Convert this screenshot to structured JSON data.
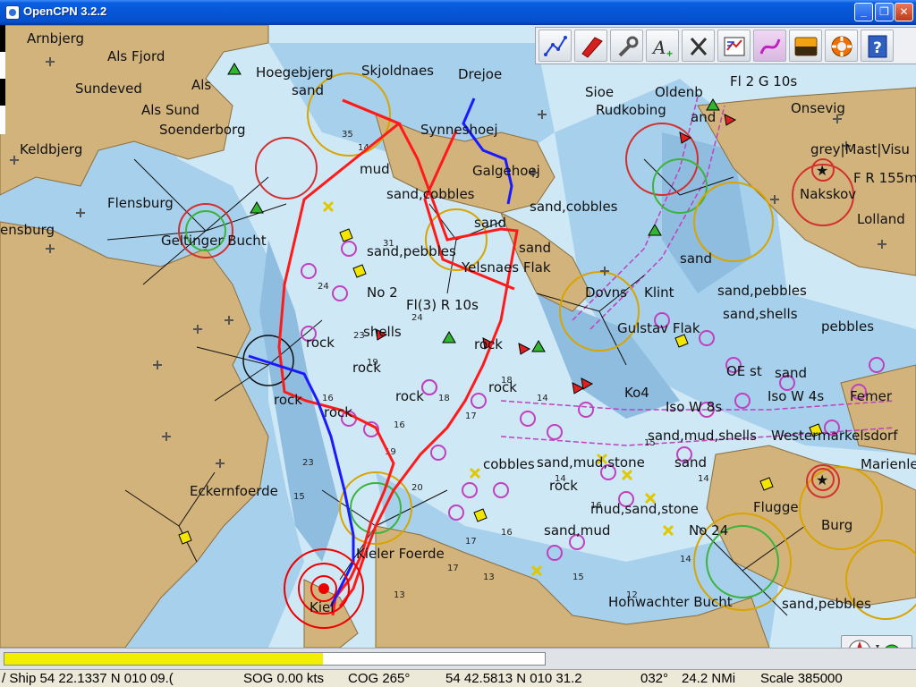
{
  "window": {
    "title": "OpenCPN 3.2.2",
    "minimize_glyph": "_",
    "maximize_glyph": "❐",
    "close_glyph": "✕"
  },
  "toolbar": {
    "tools": [
      {
        "name": "route-icon",
        "tooltip": ""
      },
      {
        "name": "ship-icon",
        "tooltip": ""
      },
      {
        "name": "wrench-icon",
        "tooltip": ""
      },
      {
        "name": "text-toggle-icon",
        "tooltip": ""
      },
      {
        "name": "clear-icon",
        "tooltip": ""
      },
      {
        "name": "route-manager-icon",
        "tooltip": ""
      },
      {
        "name": "track-icon",
        "tooltip": ""
      },
      {
        "name": "color-scheme-icon",
        "tooltip": ""
      },
      {
        "name": "lifebuoy-icon",
        "tooltip": ""
      },
      {
        "name": "help-icon",
        "tooltip": ""
      }
    ]
  },
  "chart": {
    "place_labels": {
      "arnbjerg": "Arnbjerg",
      "als_fjord": "Als Fjord",
      "sundeved": "Sundeved",
      "als": "Als",
      "als_sund": "Als Sund",
      "soenderborg": "Soenderborg",
      "keldbjerg": "Keldbjerg",
      "flensburg": "Flensburg",
      "ensburg": "ensburg",
      "geltinger_bucht": "Geltinger Bucht",
      "hoegebjerg": "Hoegebjerg",
      "sand1": "sand",
      "skjoldnaes": "Skjoldnaes",
      "drejoe": "Drejoe",
      "sioe": "Sioe",
      "rudkobing": "Rudkobing",
      "oldenburg": "Oldenb",
      "onsevig": "Onsevig",
      "synneshoej": "Synneshoej",
      "galgehoej": "Galgehoej",
      "mud1": "mud",
      "sand_cobbles": "sand,cobbles",
      "sand_cobbles2": "sand,cobbles",
      "sand_pebbles": "sand,pebbles",
      "yelsnaes_flak": "Yelsnaes Flak",
      "dovns": "Dovns",
      "klint": "Klint",
      "no2": "No 2",
      "fl3r10s": "Fl(3) R 10s",
      "shells": "shells",
      "rock1": "rock",
      "rock2": "rock",
      "rock3": "rock",
      "rock4": "rock",
      "rock5": "rock",
      "rock6": "rock",
      "rock7": "rock",
      "rock8": "rock",
      "ko4": "Ko4",
      "iso_w8s": "Iso W 8s",
      "sand_mud_shells": "sand,mud,shells",
      "sand_mud_stone": "sand,mud,stone",
      "sand_mud": "sand,mud",
      "mud_sand_stone": "mud,sand,stone",
      "kieler_foerde": "Kieler Foerde",
      "kiel": "Kiel",
      "hohwachter_bucht": "Hohwachter Bucht",
      "eckernfoerde": "Eckernfoerde",
      "nakskov": "Nakskov",
      "lolland": "Lolland",
      "grey_mast": "grey|Mast|Visu",
      "fr155m": "F R 155m",
      "sand_pebbles2": "sand,pebbles",
      "sand_shells": "sand,shells",
      "pebbles": "pebbles",
      "femer": "Femer",
      "marienleuchte": "Marienle",
      "westermarkelsdorf": "Westermarkelsdorf",
      "flugge": "Flugge",
      "burg": "Burg",
      "sand_pebbles3": "sand,pebbles",
      "oe_st": "OE st",
      "iso_w4s": "Iso W 4s",
      "gulstav": "Gulstav Flak",
      "sand2": "sand",
      "sand3": "sand",
      "sand4": "sand",
      "sand5": "sand",
      "sand6": "sand",
      "fl2g10s": "Fl 2 G 10s",
      "no24": "No 24",
      "langeland": "and",
      "cobbles": "cobbles"
    }
  },
  "status": {
    "ship": "/ Ship 54 22.1337 N   010 09.(",
    "sog": "SOG 0.00 kts",
    "cog": "COG 265°",
    "cursor": "54 42.5813 N   010 31.2",
    "bearing": "032°",
    "distance": "24.2 NMi",
    "scale": "Scale 385000",
    "progress": 0.59
  },
  "colors": {
    "land": "#d3b37c",
    "shallow": "#8fbde0",
    "mid": "#a7d0ec",
    "deep": "#cfe8f6",
    "route_red": "#ff1a1a",
    "track_blue": "#1a1aff"
  }
}
